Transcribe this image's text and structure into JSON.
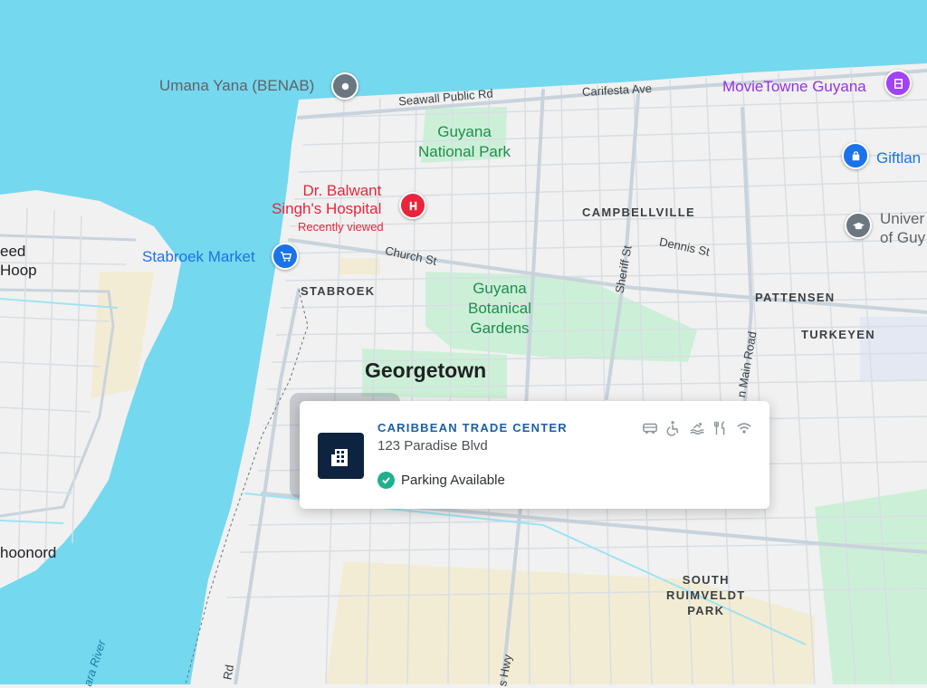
{
  "map": {
    "city": "Georgetown",
    "pois": {
      "umana_yana": "Umana Yana (BENAB)",
      "movietowne": "MovieTowne Guyana",
      "giftland": "Giftlan",
      "national_park": "Guyana\nNational Park",
      "hospital": "Dr. Balwant\nSingh's Hospital",
      "hospital_note": "Recently viewed",
      "stabroek_market": "Stabroek Market",
      "university": "Univer\nof Guy",
      "botanical_gardens": "Guyana\nBotanical\nGardens"
    },
    "streets": {
      "seawall": "Seawall Public Rd",
      "carifesta": "Carifesta Ave",
      "church": "Church St",
      "dennis": "Dennis St",
      "sheriff": "Sheriff St",
      "main_road": "n Main Road",
      "rd_bottom": "Rd",
      "hwy_bottom": "s Hwy"
    },
    "districts": {
      "campbellville": "CAMPBELLVILLE",
      "stabroek": "STABROEK",
      "pattensen": "PATTENSEN",
      "turkeyen": "TURKEYEN",
      "south_ruimveldt": "SOUTH\nRUIMVELDT\nPARK"
    },
    "west_bank": {
      "label_a": "eed\nHoop",
      "label_b": "hoonord",
      "river": "ara River"
    },
    "colors": {
      "water": "#74d8ef",
      "land": "#f1f1f1",
      "park": "#ccf0d7",
      "road": "#c9d3dc",
      "sand": "#f3ecd4"
    }
  },
  "card": {
    "title": "CARIBBEAN TRADE CENTER",
    "address": "123 Paradise Blvd",
    "status": "Parking Available",
    "icon": "office-building-icon",
    "amenities": [
      "shuttle-icon",
      "accessible-icon",
      "pool-icon",
      "restaurant-icon",
      "wifi-icon"
    ]
  }
}
